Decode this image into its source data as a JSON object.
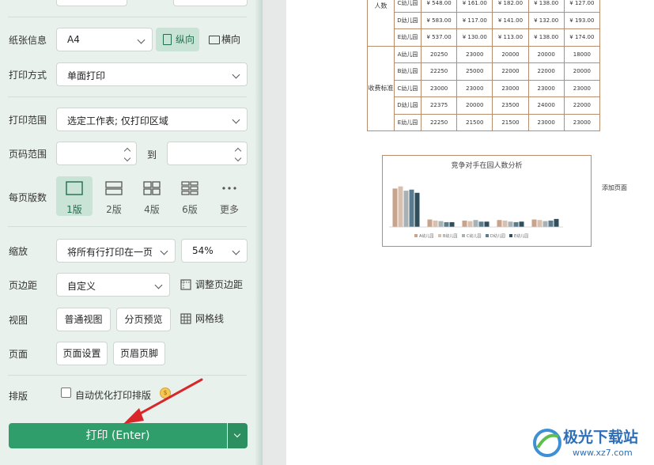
{
  "settings": {
    "paper_label": "纸张信息",
    "paper_size": "A4",
    "portrait": "纵向",
    "landscape": "横向",
    "print_mode_label": "打印方式",
    "print_mode": "单面打印",
    "range_label": "打印范围",
    "range_value": "选定工作表; 仅打印区域",
    "page_range_label": "页码范围",
    "page_range_to": "到",
    "pages_per_sheet_label": "每页版数",
    "pages_per_sheet": [
      {
        "label": "1版",
        "active": true
      },
      {
        "label": "2版",
        "active": false
      },
      {
        "label": "4版",
        "active": false
      },
      {
        "label": "6版",
        "active": false
      },
      {
        "label": "更多",
        "active": false
      }
    ],
    "scale_label": "缩放",
    "scale_mode": "将所有行打印在一页",
    "scale_percent": "54%",
    "margin_label": "页边距",
    "margin_value": "自定义",
    "adjust_margin": "调整页边距",
    "view_label": "视图",
    "normal_view": "普通视图",
    "page_break_preview": "分页预览",
    "gridlines": "网格线",
    "page_label": "页面",
    "page_setup": "页面设置",
    "header_footer": "页眉页脚",
    "layout_label": "排版",
    "auto_optimize": "自动优化打印排版",
    "print_button": "打印 (Enter)"
  },
  "preview": {
    "row_header_people": "人数",
    "row_header_fees": "收费标准",
    "people_rows": [
      {
        "name": "C幼儿园",
        "values": [
          "¥ 548.00",
          "¥ 161.00",
          "¥ 182.00",
          "¥ 138.00",
          "¥ 127.00"
        ]
      },
      {
        "name": "D幼儿园",
        "values": [
          "¥ 583.00",
          "¥ 117.00",
          "¥ 141.00",
          "¥ 132.00",
          "¥ 193.00"
        ]
      },
      {
        "name": "E幼儿园",
        "values": [
          "¥ 537.00",
          "¥ 130.00",
          "¥ 113.00",
          "¥ 138.00",
          "¥ 174.00"
        ]
      }
    ],
    "fee_rows": [
      {
        "name": "A幼儿园",
        "values": [
          "20250",
          "23000",
          "20000",
          "20000",
          "18000"
        ]
      },
      {
        "name": "B幼儿园",
        "values": [
          "22250",
          "25000",
          "22000",
          "22000",
          "20000"
        ]
      },
      {
        "name": "C幼儿园",
        "values": [
          "23000",
          "23000",
          "23000",
          "23000",
          "23000"
        ]
      },
      {
        "name": "D幼儿园",
        "values": [
          "22375",
          "20000",
          "23500",
          "24000",
          "22000"
        ]
      },
      {
        "name": "E幼儿园",
        "values": [
          "22250",
          "21500",
          "21500",
          "23000",
          "23000"
        ]
      }
    ],
    "chart_title": "竞争对手在园人数分析",
    "add_page": "添加页面",
    "chart_series": [
      {
        "name": "A幼儿园",
        "color": "#c9a38b",
        "values": [
          72,
          14,
          12,
          13,
          14
        ]
      },
      {
        "name": "B幼儿园",
        "color": "#d8c0b0",
        "values": [
          76,
          12,
          11,
          12,
          13
        ]
      },
      {
        "name": "C幼儿园",
        "color": "#a8b2b6",
        "values": [
          68,
          11,
          13,
          10,
          11
        ]
      },
      {
        "name": "D幼儿园",
        "color": "#5a7c8c",
        "values": [
          70,
          9,
          10,
          9,
          12
        ]
      },
      {
        "name": "E幼儿园",
        "color": "#2f4f5c",
        "values": [
          64,
          9,
          10,
          10,
          15
        ]
      }
    ]
  },
  "watermark": {
    "brand": "极光下载站",
    "url": "www.xz7.com"
  }
}
